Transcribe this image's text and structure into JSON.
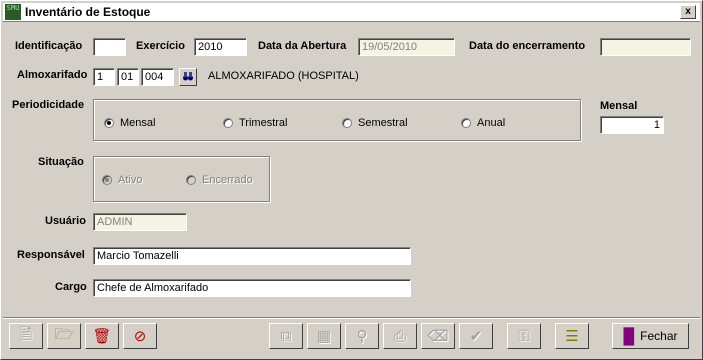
{
  "window": {
    "title": "Inventário de Estoque",
    "icon": "app-icon",
    "icon_text": "SMU",
    "close": "x"
  },
  "form": {
    "identificacao": {
      "label": "Identificação",
      "value": ""
    },
    "exercicio": {
      "label": "Exercício",
      "value": "2010"
    },
    "data_abertura": {
      "label": "Data da Abertura",
      "value": "19/05/2010"
    },
    "data_encerramento": {
      "label": "Data do encerramento",
      "value": ""
    },
    "almoxarifado": {
      "label": "Almoxarifado",
      "code1": "1",
      "code2": "01",
      "code3": "004",
      "name": "ALMOXARIFADO (HOSPITAL)"
    },
    "periodicidade": {
      "label": "Periodicidade",
      "options": [
        "Mensal",
        "Trimestral",
        "Semestral",
        "Anual"
      ],
      "selected": "Mensal"
    },
    "mensal": {
      "label": "Mensal",
      "value": "1"
    },
    "situacao": {
      "label": "Situação",
      "options": [
        "Ativo",
        "Encerrado"
      ],
      "selected": "Ativo"
    },
    "usuario": {
      "label": "Usuário",
      "value": "ADMIN"
    },
    "responsavel": {
      "label": "Responsável",
      "value": "Marcio Tomazelli"
    },
    "cargo": {
      "label": "Cargo",
      "value": "Chefe de Almoxarifado"
    }
  },
  "toolbar": {
    "buttons": [
      {
        "icon": "new-document-icon",
        "enabled": false
      },
      {
        "icon": "open-folder-icon",
        "enabled": true
      },
      {
        "icon": "delete-document-icon",
        "enabled": true
      },
      {
        "icon": "cancel-icon",
        "enabled": true
      },
      {
        "icon": "copy-icon",
        "enabled": false
      },
      {
        "icon": "calculator-icon",
        "enabled": false
      },
      {
        "icon": "search-icon",
        "enabled": false
      },
      {
        "icon": "print-icon",
        "enabled": false
      },
      {
        "icon": "eraser-icon",
        "enabled": false
      },
      {
        "icon": "confirm-icon",
        "enabled": false
      },
      {
        "icon": "key-icon",
        "enabled": false
      },
      {
        "icon": "list-icon",
        "enabled": true
      }
    ],
    "close_label": "Fechar",
    "close_icon": "exit-door-icon"
  },
  "colors": {
    "face": "#d4d0c8",
    "readonly_field": "#f4f4e4",
    "disabled_text": "#808080"
  }
}
